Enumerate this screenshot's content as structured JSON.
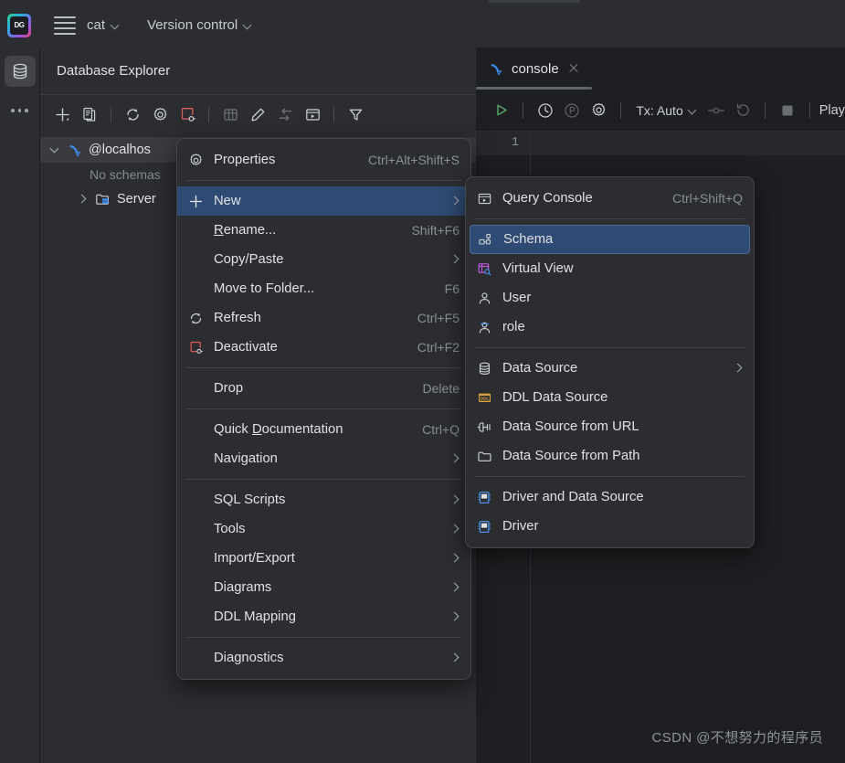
{
  "app": {
    "logo_text": "DG",
    "watermark": "CSDN @不想努力的程序员"
  },
  "toolbar": {
    "menu_icon": "hamburger-menu-icon",
    "project": "cat",
    "version_control": "Version control"
  },
  "rail": {
    "database_icon": "database-icon",
    "more_icon": "more-options-icon"
  },
  "explorer": {
    "title": "Database Explorer",
    "toolbar_buttons": [
      {
        "name": "add-new-icon",
        "label": "New"
      },
      {
        "name": "duplicate-icon",
        "label": "Duplicate"
      },
      {
        "name": "refresh-icon",
        "label": "Refresh"
      },
      {
        "name": "settings-icon",
        "label": "Data Source Properties"
      },
      {
        "name": "disconnect-icon",
        "label": "Disconnect"
      },
      {
        "name": "table-editor-icon",
        "label": "Open Table Editor"
      },
      {
        "name": "edit-icon",
        "label": "Modify Object"
      },
      {
        "name": "jump-to-icon",
        "label": "Jump to Query Console"
      },
      {
        "name": "query-console-icon",
        "label": "Open Console"
      },
      {
        "name": "filter-icon",
        "label": "Filter"
      }
    ],
    "tree": {
      "root": {
        "label": "@localhos",
        "icon": "mysql-dolphin-icon",
        "note": "No schemas",
        "children": [
          {
            "label": "Server",
            "icon": "server-folder-icon"
          }
        ]
      }
    }
  },
  "editor": {
    "tab": {
      "label": "console",
      "icon": "mysql-dolphin-icon",
      "close_icon": "close-icon"
    },
    "toolbar": {
      "execute_icon": "run-play-icon",
      "history_icon": "history-clock-icon",
      "parameters_icon": "parameters-icon",
      "settings_icon": "settings-gear-icon",
      "tx_label": "Tx: Auto",
      "commit_icon": "commit-icon",
      "rollback_icon": "rollback-icon",
      "stop_icon": "stop-icon",
      "play_label": "Play"
    },
    "line_numbers": [
      "1"
    ]
  },
  "context_menu": {
    "items": [
      {
        "label": "Properties",
        "shortcut": "Ctrl+Alt+Shift+S",
        "icon": "settings-gear-icon",
        "submenu": false,
        "highlight": false
      },
      {
        "separator": true
      },
      {
        "label": "New",
        "shortcut": "",
        "icon": "plus-icon",
        "submenu": true,
        "highlight": true
      },
      {
        "label": "Rename...",
        "label_html": "<u>R</u>ename...",
        "shortcut": "Shift+F6",
        "icon": "",
        "submenu": false,
        "highlight": false
      },
      {
        "label": "Copy/Paste",
        "shortcut": "",
        "icon": "",
        "submenu": true,
        "highlight": false
      },
      {
        "label": "Move to Folder...",
        "shortcut": "F6",
        "icon": "",
        "submenu": false,
        "highlight": false
      },
      {
        "label": "Refresh",
        "shortcut": "Ctrl+F5",
        "icon": "refresh-icon",
        "submenu": false,
        "highlight": false
      },
      {
        "label": "Deactivate",
        "shortcut": "Ctrl+F2",
        "icon": "disconnect-icon",
        "submenu": false,
        "highlight": false
      },
      {
        "separator": true
      },
      {
        "label": "Drop",
        "shortcut": "Delete",
        "icon": "",
        "submenu": false,
        "highlight": false
      },
      {
        "separator": true
      },
      {
        "label": "Quick Documentation",
        "label_html": "Quick <u>D</u>ocumentation",
        "shortcut": "Ctrl+Q",
        "icon": "",
        "submenu": false,
        "highlight": false
      },
      {
        "label": "Navigation",
        "shortcut": "",
        "icon": "",
        "submenu": true,
        "highlight": false
      },
      {
        "separator": true
      },
      {
        "label": "SQL Scripts",
        "shortcut": "",
        "icon": "",
        "submenu": true,
        "highlight": false
      },
      {
        "label": "Tools",
        "shortcut": "",
        "icon": "",
        "submenu": true,
        "highlight": false
      },
      {
        "label": "Import/Export",
        "shortcut": "",
        "icon": "",
        "submenu": true,
        "highlight": false
      },
      {
        "label": "Diagrams",
        "shortcut": "",
        "icon": "",
        "submenu": true,
        "highlight": false
      },
      {
        "label": "DDL Mapping",
        "shortcut": "",
        "icon": "",
        "submenu": true,
        "highlight": false
      },
      {
        "separator": true
      },
      {
        "label": "Diagnostics",
        "shortcut": "",
        "icon": "",
        "submenu": true,
        "highlight": false
      }
    ]
  },
  "submenu": {
    "items": [
      {
        "label": "Query Console",
        "shortcut": "Ctrl+Shift+Q",
        "icon": "query-console-icon",
        "submenu": false,
        "highlight": false
      },
      {
        "separator": true
      },
      {
        "label": "Schema",
        "shortcut": "",
        "icon": "schema-icon",
        "submenu": false,
        "highlight": true
      },
      {
        "label": "Virtual View",
        "shortcut": "",
        "icon": "virtual-view-icon",
        "submenu": false,
        "highlight": false
      },
      {
        "label": "User",
        "shortcut": "",
        "icon": "user-icon",
        "submenu": false,
        "highlight": false
      },
      {
        "label": "role",
        "shortcut": "",
        "icon": "role-icon",
        "submenu": false,
        "highlight": false
      },
      {
        "separator": true
      },
      {
        "label": "Data Source",
        "shortcut": "",
        "icon": "data-source-icon",
        "submenu": true,
        "highlight": false
      },
      {
        "label": "DDL Data Source",
        "shortcut": "",
        "icon": "ddl-data-source-icon",
        "submenu": false,
        "highlight": false
      },
      {
        "label": "Data Source from URL",
        "shortcut": "",
        "icon": "data-source-url-icon",
        "submenu": false,
        "highlight": false
      },
      {
        "label": "Data Source from Path",
        "shortcut": "",
        "icon": "data-source-path-icon",
        "submenu": false,
        "highlight": false
      },
      {
        "separator": true
      },
      {
        "label": "Driver and Data Source",
        "shortcut": "",
        "icon": "driver-data-source-icon",
        "submenu": false,
        "highlight": false
      },
      {
        "label": "Driver",
        "shortcut": "",
        "icon": "driver-icon",
        "submenu": false,
        "highlight": false
      }
    ]
  },
  "colors": {
    "panel_bg": "#2b2d30",
    "editor_bg": "#1e1f22",
    "menu_highlight": "#2f4b73",
    "accent_blue": "#3574f0",
    "run_green": "#59a869",
    "disconnect_red": "#db5c5c"
  }
}
